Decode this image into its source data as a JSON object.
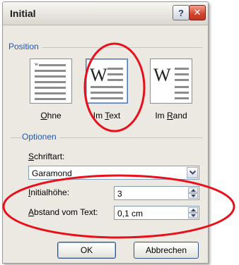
{
  "dialog": {
    "title": "Initial",
    "help_symbol": "?",
    "close_symbol": "✕"
  },
  "position": {
    "group_label": "Position",
    "options": [
      {
        "label": "Ohne",
        "underline_char": "O",
        "rest": "hne",
        "selected": false
      },
      {
        "label": "Im Text",
        "underline_char": "T",
        "prefix": "Im ",
        "rest": "ext",
        "selected": true
      },
      {
        "label": "Im Rand",
        "underline_char": "R",
        "prefix": "Im ",
        "rest": "and",
        "selected": false
      }
    ],
    "icon_glyph": "W",
    "small_glyph": "w"
  },
  "options": {
    "group_label": "Optionen",
    "font_label_u": "S",
    "font_label_rest": "chriftart:",
    "font_value": "Garamond",
    "height_label_u": "I",
    "height_label_rest": "nitialhöhe:",
    "height_value": "3",
    "distance_label_u": "A",
    "distance_label_rest": "bstand vom Text:",
    "distance_value": "0,1 cm"
  },
  "buttons": {
    "ok": "OK",
    "cancel": "Abbrechen"
  },
  "colors": {
    "annotation": "#e8101a",
    "group_label": "#1f55b0",
    "dialog_bg": "#ece9e3"
  }
}
